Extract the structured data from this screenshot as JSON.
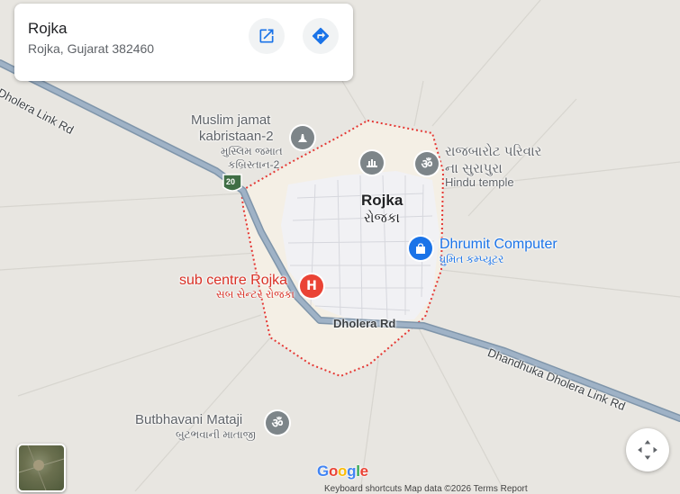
{
  "place_card": {
    "title": "Rojka",
    "address": "Rojka, Gujarat 382460",
    "open_icon": "open-in-new-icon",
    "directions_icon": "directions-icon"
  },
  "town": {
    "name_en": "Rojka",
    "name_gu": "રોજકા"
  },
  "roads": {
    "link_rd_nw": "Dholera Link Rd",
    "dholera_rd": "Dholera Rd",
    "dhandhuka_link": "Dhandhuka Dholera Link Rd",
    "shield": "20"
  },
  "pois": {
    "kabristan_en1": "Muslim jamat",
    "kabristan_en2": "kabristaan-2",
    "kabristan_gu1": "મુસ્લિમ જમાત",
    "kabristan_gu2": "કબ્રિસ્તાન-2",
    "rajbarot_1": "રાજબારોટ પરિવાર",
    "rajbarot_2": "ના સુરાપુરા",
    "hindu_temple": "Hindu temple",
    "dhrumit_en": "Dhrumit Computer",
    "dhrumit_gu": "ધ્રુમિત કમ્પ્યૂટર",
    "subcentre_en": "sub centre Rojka",
    "subcentre_gu": "સબ સેન્ટર રોજકા",
    "butbhavani_en": "Butbhavani Mataji",
    "butbhavani_gu": "બુટભવાની માતાજી",
    "hospital_glyph": "H",
    "om_glyph": "ॐ"
  },
  "footer": {
    "google": [
      "G",
      "o",
      "o",
      "g",
      "l",
      "e"
    ],
    "attribution": "Keyboard shortcuts   Map data ©2026   Terms   Report"
  },
  "colors": {
    "accent": "#1a73e8",
    "hospital": "#ea4335",
    "hospital_text": "#d93025",
    "poi_grey": "#7d8589",
    "shopping": "#1a73e8",
    "boundary": "#e53935",
    "road": "#8ea0b3"
  }
}
